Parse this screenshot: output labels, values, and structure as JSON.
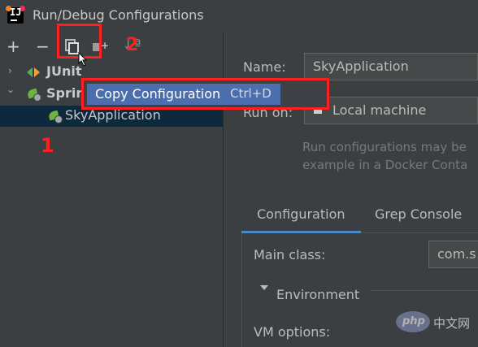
{
  "window": {
    "title": "Run/Debug Configurations"
  },
  "toolbar": {
    "add_icon": "plus-icon",
    "remove_icon": "minus-icon",
    "copy_icon": "copy-icon",
    "folder_icon": "new-folder-icon",
    "sort_icon": "sort-icon",
    "add_glyph": "+",
    "remove_glyph": "−",
    "sort_glyph": "↓ª"
  },
  "annotations": {
    "marker_1": "1",
    "marker_2": "2",
    "highlight_color": "#ff1f1f"
  },
  "tree": {
    "items": [
      {
        "label": "JUnit",
        "expanded": false,
        "icon": "junit-icon"
      },
      {
        "label": "Spring",
        "expanded": true,
        "icon": "spring-boot-icon"
      },
      {
        "label": "SkyApplication",
        "selected": true,
        "icon": "spring-boot-icon"
      }
    ],
    "chev_collapsed": "›",
    "chev_expanded": "⌄"
  },
  "popup": {
    "label": "Copy Configuration",
    "shortcut": "Ctrl+D"
  },
  "form": {
    "name_label": "Name:",
    "name_value": "SkyApplication",
    "run_on_label": "Run on:",
    "run_on_value": "Local machine",
    "hint_line1": "Run configurations may be",
    "hint_line2": "example in a Docker Conta"
  },
  "tabs": [
    {
      "label": "Configuration",
      "active": true
    },
    {
      "label": "Grep Console",
      "active": false
    }
  ],
  "config": {
    "main_class_label": "Main class:",
    "main_class_value": "com.s",
    "environment_label": "Environment",
    "vm_options_label": "VM options:"
  },
  "watermark": {
    "logo": "php",
    "text": "中文网"
  },
  "colors": {
    "selection": "#0d293e",
    "popup_highlight": "#4b6eaf",
    "tab_underline": "#4a88c7"
  }
}
